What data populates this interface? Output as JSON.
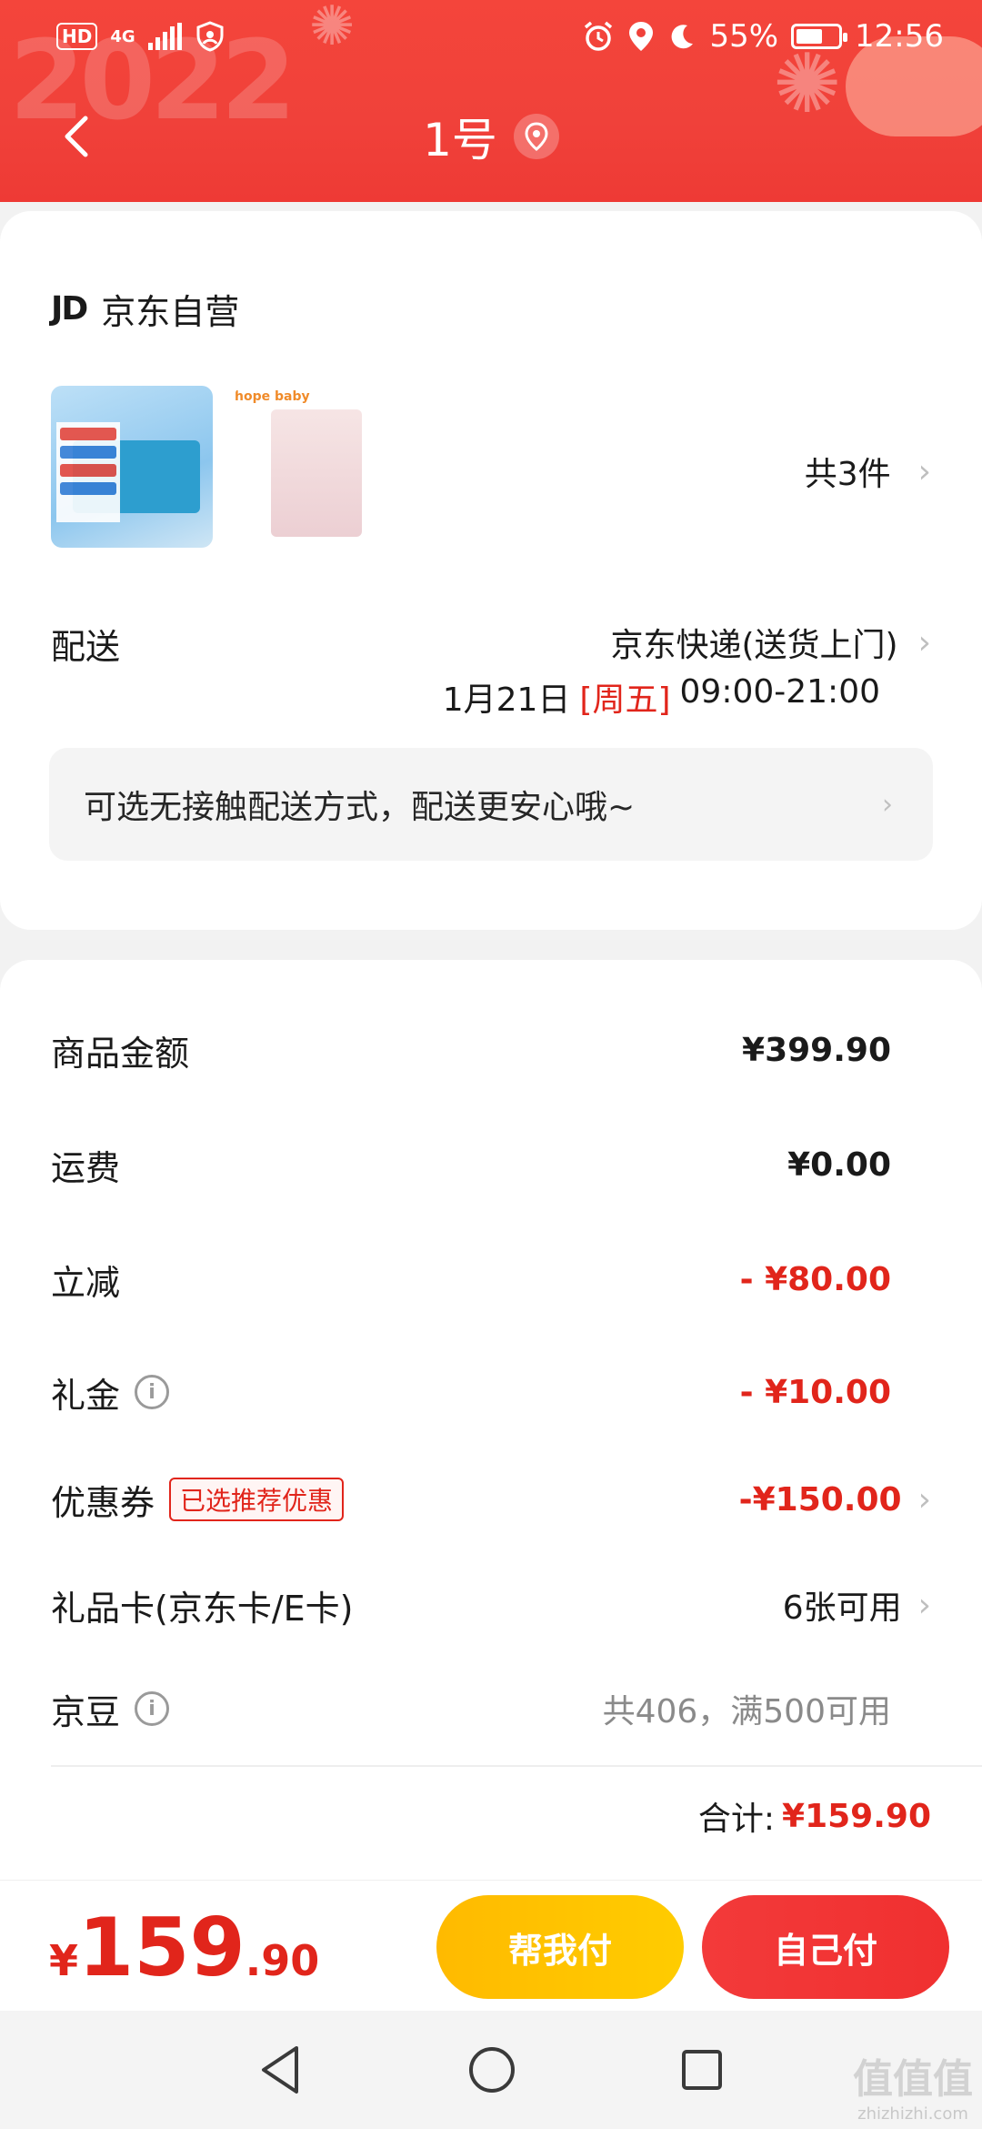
{
  "status_bar": {
    "hd": "HD",
    "network": "4G",
    "battery": "55%",
    "time": "12:56",
    "icons": [
      "alarm-icon",
      "location-icon",
      "moon-icon",
      "battery-icon"
    ]
  },
  "header": {
    "title": "1号",
    "deco_year": "2022",
    "accent": "#f0413a"
  },
  "shop": {
    "logo": "JD",
    "name": "京东自营"
  },
  "products": {
    "count_label": "共3件",
    "thumb2_brand": "hope baby"
  },
  "delivery": {
    "label": "配送",
    "method": "京东快递(送货上门)",
    "date": "1月21日",
    "weekday": "[周五]",
    "time_window": "09:00-21:00",
    "notice": "可选无接触配送方式，配送更安心哦~"
  },
  "fees": {
    "goods_label": "商品金额",
    "goods_value": "¥399.90",
    "shipping_label": "运费",
    "shipping_value": "¥0.00",
    "discount_label": "立减",
    "discount_value": "- ¥80.00",
    "gift_cash_label": "礼金",
    "gift_cash_value": "- ¥10.00",
    "coupon_label": "优惠券",
    "coupon_tag": "已选推荐优惠",
    "coupon_value": "-¥150.00",
    "giftcard_label": "礼品卡(京东卡/E卡)",
    "giftcard_value": "6张可用",
    "jingdou_label": "京豆",
    "jingdou_value": "共406，满500可用"
  },
  "total": {
    "label": "合计:",
    "value": "¥159.90"
  },
  "bottom": {
    "currency": "¥",
    "price_int": "159",
    "price_dec": ".90",
    "help_pay": "帮我付",
    "self_pay": "自己付"
  },
  "watermark": {
    "big": "值值值",
    "site": "zhizhizhi.com"
  },
  "colors": {
    "red": "#e1251b",
    "yellow": "#ffc000",
    "gray_text": "#8a8a8a"
  }
}
